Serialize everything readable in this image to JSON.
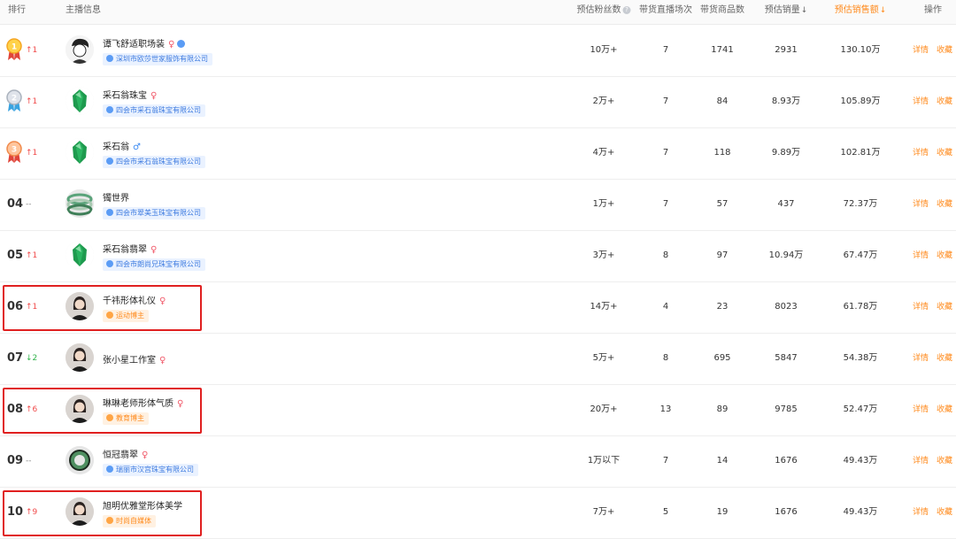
{
  "header": {
    "rank": "排行",
    "streamer": "主播信息",
    "fans": "预估粉丝数",
    "sessions": "带货直播场次",
    "products": "带货商品数",
    "volume": "预估销量",
    "sales": "预估销售额",
    "ops": "操作",
    "sort_icon": "↓"
  },
  "actions": {
    "detail": "详情",
    "fav": "收藏"
  },
  "rows": [
    {
      "rank": "",
      "medal": "gold",
      "trend": "↑1",
      "trend_dir": "up",
      "avatar": "sketch-avatar",
      "name": "谭飞舒适职场装",
      "gender": "♀",
      "gender_type": "f",
      "vip": true,
      "tag": "深圳市欧莎世家服饰有限公司",
      "tag_type": "blue",
      "fans": "10万+",
      "sessions": "7",
      "products": "1741",
      "volume": "2931",
      "sales": "130.10万"
    },
    {
      "rank": "",
      "medal": "silver",
      "trend": "↑1",
      "trend_dir": "up",
      "avatar": "jade-avatar",
      "name": "采石翁珠宝",
      "gender": "♀",
      "gender_type": "f",
      "vip": false,
      "tag": "四会市采石翁珠宝有限公司",
      "tag_type": "blue",
      "fans": "2万+",
      "sessions": "7",
      "products": "84",
      "volume": "8.93万",
      "sales": "105.89万"
    },
    {
      "rank": "",
      "medal": "bronze",
      "trend": "↑1",
      "trend_dir": "up",
      "avatar": "jade-avatar",
      "name": "采石翁",
      "gender": "♂",
      "gender_type": "m",
      "vip": false,
      "tag": "四会市采石翁珠宝有限公司",
      "tag_type": "blue",
      "fans": "4万+",
      "sessions": "7",
      "products": "118",
      "volume": "9.89万",
      "sales": "102.81万"
    },
    {
      "rank": "04",
      "medal": "",
      "trend": "--",
      "trend_dir": "same",
      "avatar": "jade-bracelet-avatar",
      "name": "镯世界",
      "gender": "",
      "gender_type": "",
      "vip": false,
      "tag": "四会市翠美玉珠宝有限公司",
      "tag_type": "blue",
      "fans": "1万+",
      "sessions": "7",
      "products": "57",
      "volume": "437",
      "sales": "72.37万"
    },
    {
      "rank": "05",
      "medal": "",
      "trend": "↑1",
      "trend_dir": "up",
      "avatar": "jade-avatar",
      "name": "采石翁翡翠",
      "gender": "♀",
      "gender_type": "f",
      "vip": false,
      "tag": "四会市朗尚兄珠宝有限公司",
      "tag_type": "blue",
      "fans": "3万+",
      "sessions": "8",
      "products": "97",
      "volume": "10.94万",
      "sales": "67.47万"
    },
    {
      "rank": "06",
      "medal": "",
      "trend": "↑1",
      "trend_dir": "up",
      "avatar": "portrait-avatar",
      "name": "千祎形体礼仪",
      "gender": "♀",
      "gender_type": "f",
      "vip": false,
      "tag": "运动博主",
      "tag_type": "orange",
      "fans": "14万+",
      "sessions": "4",
      "products": "23",
      "volume": "8023",
      "sales": "61.78万"
    },
    {
      "rank": "07",
      "medal": "",
      "trend": "↓2",
      "trend_dir": "down",
      "avatar": "portrait-avatar",
      "name": "张小星工作室",
      "gender": "♀",
      "gender_type": "f",
      "vip": false,
      "tag": "",
      "tag_type": "",
      "fans": "5万+",
      "sessions": "8",
      "products": "695",
      "volume": "5847",
      "sales": "54.38万"
    },
    {
      "rank": "08",
      "medal": "",
      "trend": "↑6",
      "trend_dir": "up",
      "avatar": "portrait-avatar",
      "name": "琳琳老师形体气质",
      "gender": "♀",
      "gender_type": "f",
      "vip": false,
      "tag": "教育博主",
      "tag_type": "orange",
      "fans": "20万+",
      "sessions": "13",
      "products": "89",
      "volume": "9785",
      "sales": "52.47万"
    },
    {
      "rank": "09",
      "medal": "",
      "trend": "--",
      "trend_dir": "same",
      "avatar": "jade-ring-avatar",
      "name": "恒冠翡翠",
      "gender": "♀",
      "gender_type": "f",
      "vip": false,
      "tag": "瑞丽市汉宫珠宝有限公司",
      "tag_type": "blue",
      "fans": "1万以下",
      "sessions": "7",
      "products": "14",
      "volume": "1676",
      "sales": "49.43万"
    },
    {
      "rank": "10",
      "medal": "",
      "trend": "↑9",
      "trend_dir": "up",
      "avatar": "portrait-avatar",
      "name": "旭明优雅堂形体美学",
      "gender": "",
      "gender_type": "",
      "vip": false,
      "tag": "时尚自媒体",
      "tag_type": "orange",
      "fans": "7万+",
      "sessions": "5",
      "products": "19",
      "volume": "1676",
      "sales": "49.43万"
    }
  ],
  "highlighted_rows": [
    5,
    7,
    9
  ],
  "colors": {
    "accent": "#ff8a1c",
    "up": "#f04a4a",
    "down": "#2fb24a",
    "highlight": "#e02020",
    "tag_blue": "#3d7be0"
  }
}
